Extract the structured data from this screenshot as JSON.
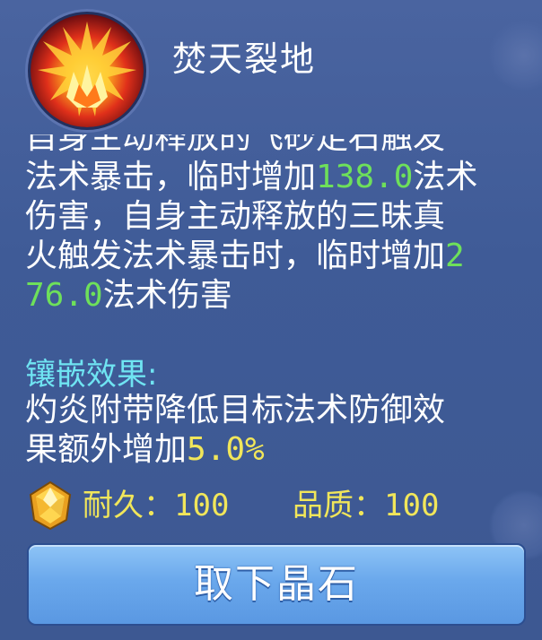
{
  "skill": {
    "name": "焚天裂地",
    "icon": "flame-burst-icon"
  },
  "description": {
    "line0_clipped": "自身主动释放的飞砂走石触发",
    "line1_pre": "法术暴击，临时增加",
    "line1_num": "138.0",
    "line1_post": "法术",
    "line2": "伤害，自身主动释放的三昧真",
    "line3_pre": "火触发法术暴击时，临时增加",
    "line3_num": "2",
    "line4_num": "76.0",
    "line4_post": "法术伤害"
  },
  "inlay": {
    "title": "镶嵌效果:",
    "line1": "灼炎附带降低目标法术防御效",
    "line2_pre": "果额外增加",
    "line2_num": "5.0%"
  },
  "stats": {
    "icon": "yellow-gem-icon",
    "durability_label": "耐久：",
    "durability_value": "100",
    "quality_label": "品质：",
    "quality_value": "100"
  },
  "action": {
    "label": "取下晶石"
  },
  "colors": {
    "panel_bg": "#3f5b97",
    "highlight_green": "#6ee05a",
    "highlight_yellow": "#f1e65a",
    "inlay_title": "#6fe4f2",
    "button_blue": "#6aa8ec"
  }
}
